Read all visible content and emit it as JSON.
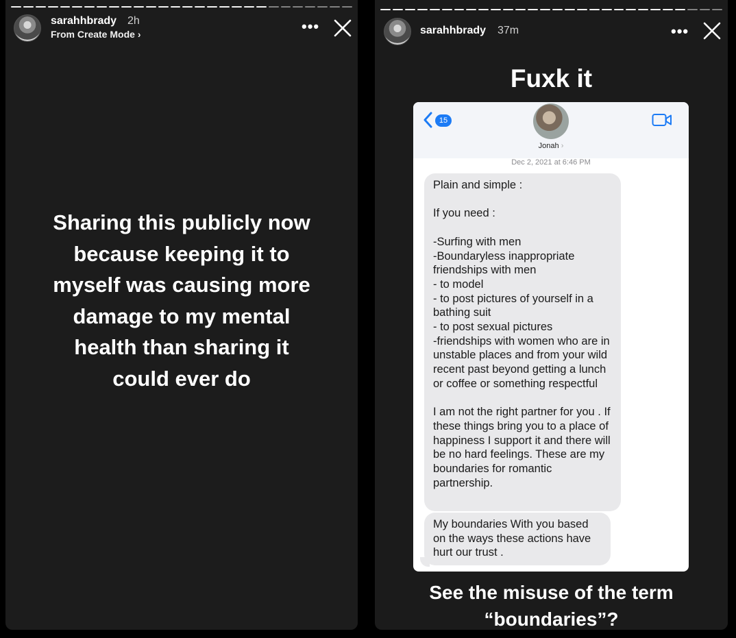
{
  "left_story": {
    "username": "sarahhbrady",
    "time": "2h",
    "subline": "From Create Mode",
    "subline_chevron": "›",
    "more": "•••",
    "text": "Sharing this publicly now because keeping it to myself was causing more damage to my mental health than sharing it could ever do"
  },
  "right_story": {
    "username": "sarahhbrady",
    "time": "37m",
    "more": "•••",
    "caption_top": "Fuxk it",
    "caption_bottom": "See the misuse of the term “boundaries”?",
    "screenshot": {
      "back_count": "15",
      "contact_name": "Jonah",
      "contact_chevron": "›",
      "date": "Dec 2, 2021 at 6:46 PM",
      "messages": [
        "Plain and simple :\n\nIf you need :\n\n-Surfing with men\n-Boundaryless inappropriate friendships with men\n- to model\n- to post pictures of yourself in a bathing suit\n- to post sexual pictures\n-friendships with women who are in unstable places and from your wild recent past beyond getting a lunch or coffee or something respectful\n\nI am not the right partner for you . If these things bring you to a place of happiness I support it and there will be no hard feelings. These are my boundaries for romantic partnership.",
        "My boundaries With you based on the ways these actions have hurt our trust ."
      ]
    }
  }
}
